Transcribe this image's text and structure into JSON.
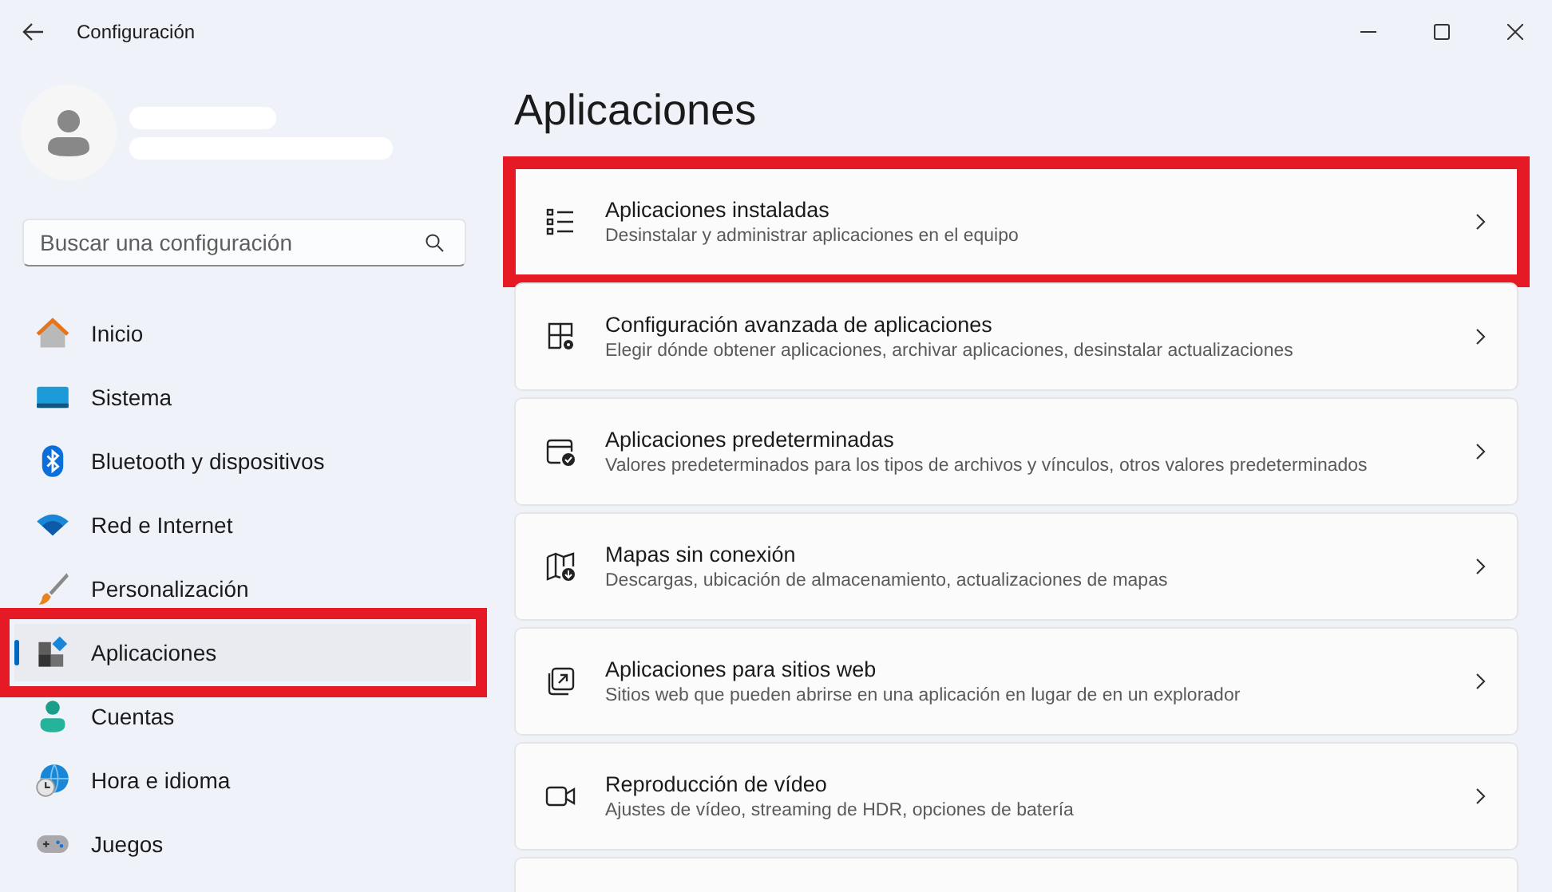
{
  "window": {
    "title": "Configuración"
  },
  "search": {
    "placeholder": "Buscar una configuración"
  },
  "sidebar": {
    "items": [
      {
        "label": "Inicio",
        "selected": false,
        "highlighted": false
      },
      {
        "label": "Sistema",
        "selected": false,
        "highlighted": false
      },
      {
        "label": "Bluetooth y dispositivos",
        "selected": false,
        "highlighted": false
      },
      {
        "label": "Red e Internet",
        "selected": false,
        "highlighted": false
      },
      {
        "label": "Personalización",
        "selected": false,
        "highlighted": false
      },
      {
        "label": "Aplicaciones",
        "selected": true,
        "highlighted": true
      },
      {
        "label": "Cuentas",
        "selected": false,
        "highlighted": false
      },
      {
        "label": "Hora e idioma",
        "selected": false,
        "highlighted": false
      },
      {
        "label": "Juegos",
        "selected": false,
        "highlighted": false
      }
    ]
  },
  "page": {
    "title": "Aplicaciones",
    "cards": [
      {
        "title": "Aplicaciones instaladas",
        "subtitle": "Desinstalar y administrar aplicaciones en el equipo",
        "highlighted": true
      },
      {
        "title": "Configuración avanzada de aplicaciones",
        "subtitle": "Elegir dónde obtener aplicaciones, archivar aplicaciones, desinstalar actualizaciones",
        "highlighted": false
      },
      {
        "title": "Aplicaciones predeterminadas",
        "subtitle": "Valores predeterminados para los tipos de archivos y vínculos, otros valores predeterminados",
        "highlighted": false
      },
      {
        "title": "Mapas sin conexión",
        "subtitle": "Descargas, ubicación de almacenamiento, actualizaciones de mapas",
        "highlighted": false
      },
      {
        "title": "Aplicaciones para sitios web",
        "subtitle": "Sitios web que pueden abrirse en una aplicación en lugar de en un explorador",
        "highlighted": false
      },
      {
        "title": "Reproducción de vídeo",
        "subtitle": "Ajustes de vídeo, streaming de HDR, opciones de batería",
        "highlighted": false
      }
    ]
  }
}
